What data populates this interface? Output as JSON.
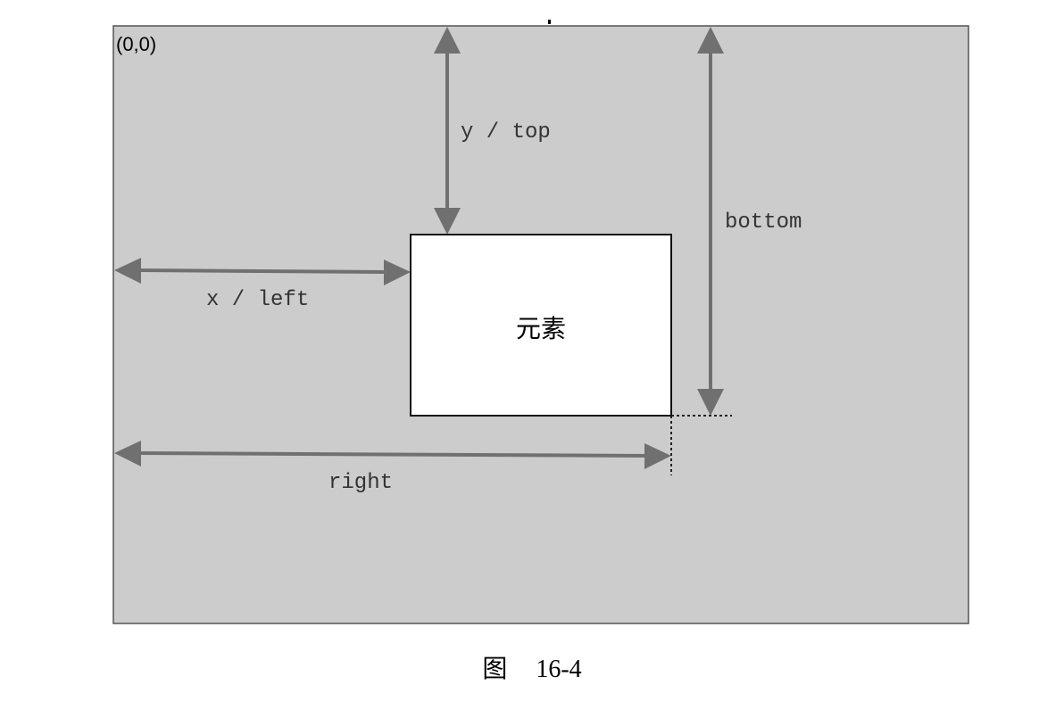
{
  "diagram": {
    "origin": "(0,0)",
    "element_label": "元素",
    "dimensions": {
      "top": "y / top",
      "left": "x / left",
      "right": "right",
      "bottom": "bottom"
    },
    "colors": {
      "canvas": "#cccccc",
      "arrow": "#707070",
      "element": "#ffffff",
      "border": "#555555"
    }
  },
  "caption": {
    "prefix": "图",
    "number": "16-4"
  }
}
